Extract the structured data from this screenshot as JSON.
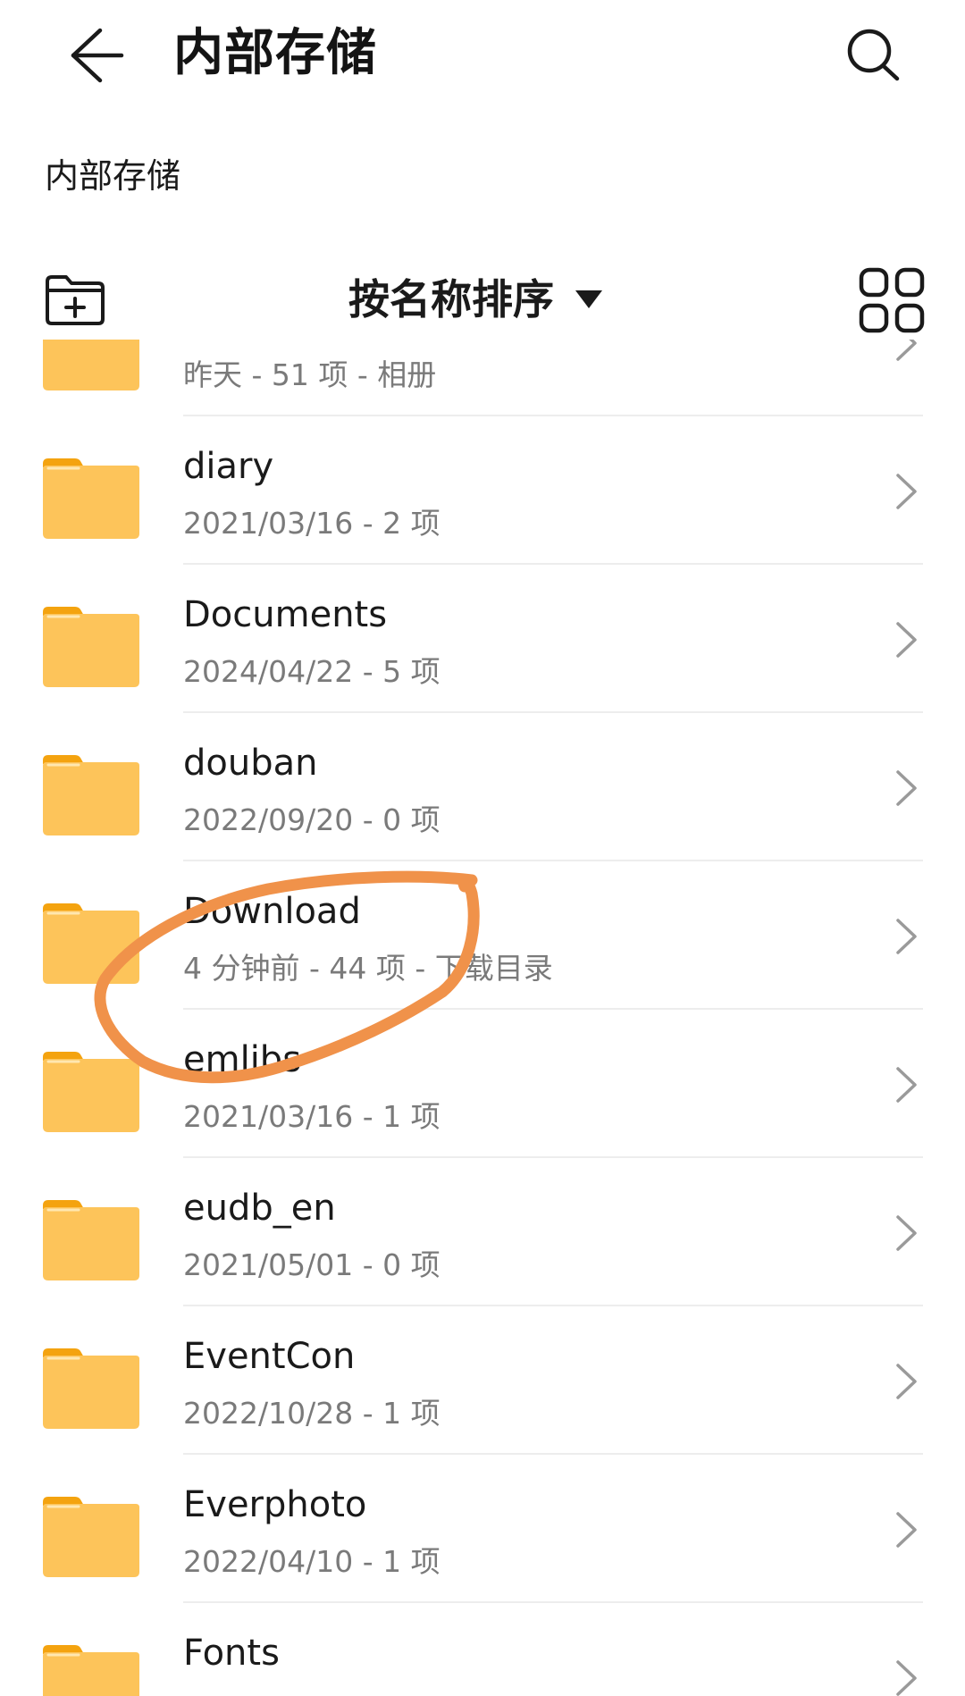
{
  "header": {
    "title": "内部存储",
    "back_icon": "arrow-left-icon",
    "search_icon": "search-icon"
  },
  "breadcrumb": {
    "label": "内部存储"
  },
  "toolbar": {
    "sort_label": "按名称排序",
    "new_folder_icon": "folder-plus-icon",
    "grid_icon": "grid-view-icon"
  },
  "files": [
    {
      "name": "",
      "meta": "昨天 - 51 项 - 相册"
    },
    {
      "name": "diary",
      "meta": "2021/03/16 - 2 项"
    },
    {
      "name": "Documents",
      "meta": "2024/04/22 - 5 项"
    },
    {
      "name": "douban",
      "meta": "2022/09/20 - 0 项"
    },
    {
      "name": "Download",
      "meta": "4 分钟前 - 44 项 - 下载目录"
    },
    {
      "name": "emlibs",
      "meta": "2021/03/16 - 1 项"
    },
    {
      "name": "eudb_en",
      "meta": "2021/05/01 - 0 项"
    },
    {
      "name": "EventCon",
      "meta": "2022/10/28 - 1 项"
    },
    {
      "name": "Everphoto",
      "meta": "2022/04/10 - 1 项"
    },
    {
      "name": "Fonts",
      "meta": ""
    }
  ],
  "colors": {
    "folder_body": "#FDC45A",
    "folder_tab": "#F4A30F",
    "annotation_stroke": "#F0924A",
    "text_primary": "#1A1A1A",
    "text_secondary": "#7A7A7A"
  }
}
